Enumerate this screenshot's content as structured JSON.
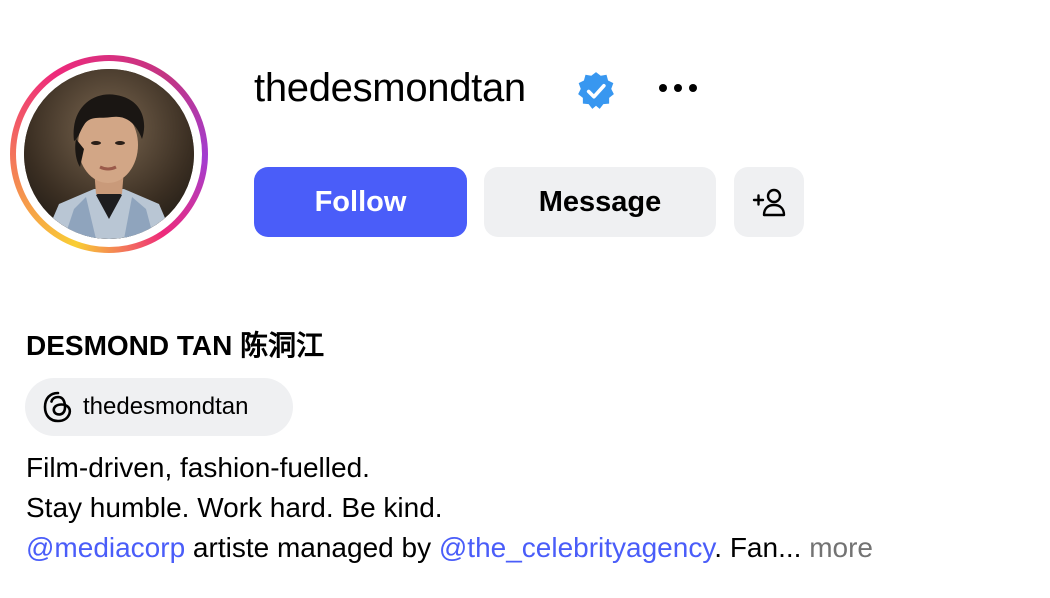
{
  "profile": {
    "username": "thedesmondtan",
    "verified": true,
    "display_name": "DESMOND TAN 陈洞江",
    "avatar_icon": "profile-photo",
    "story_ring_colors": [
      "#f9ce34",
      "#ee2a7b",
      "#a23dd1"
    ]
  },
  "actions": {
    "follow_label": "Follow",
    "message_label": "Message",
    "add_user_icon": "add-user-icon",
    "more_icon": "more-options-icon"
  },
  "threads": {
    "icon": "threads-icon",
    "handle": "thedesmondtan"
  },
  "bio": {
    "line1": "Film-driven, fashion-fuelled.",
    "line2": "Stay humble. Work hard. Be kind.",
    "mention1": "@mediacorp",
    "middle_text": " artiste managed by ",
    "mention2": "@the_celebrityagency",
    "tail_text": ". Fan...",
    "more_label": "more"
  },
  "colors": {
    "accent": "#4a5df9",
    "secondary_button": "#eff0f2",
    "verified_badge": "#3897f0",
    "muted_text": "#737373"
  }
}
